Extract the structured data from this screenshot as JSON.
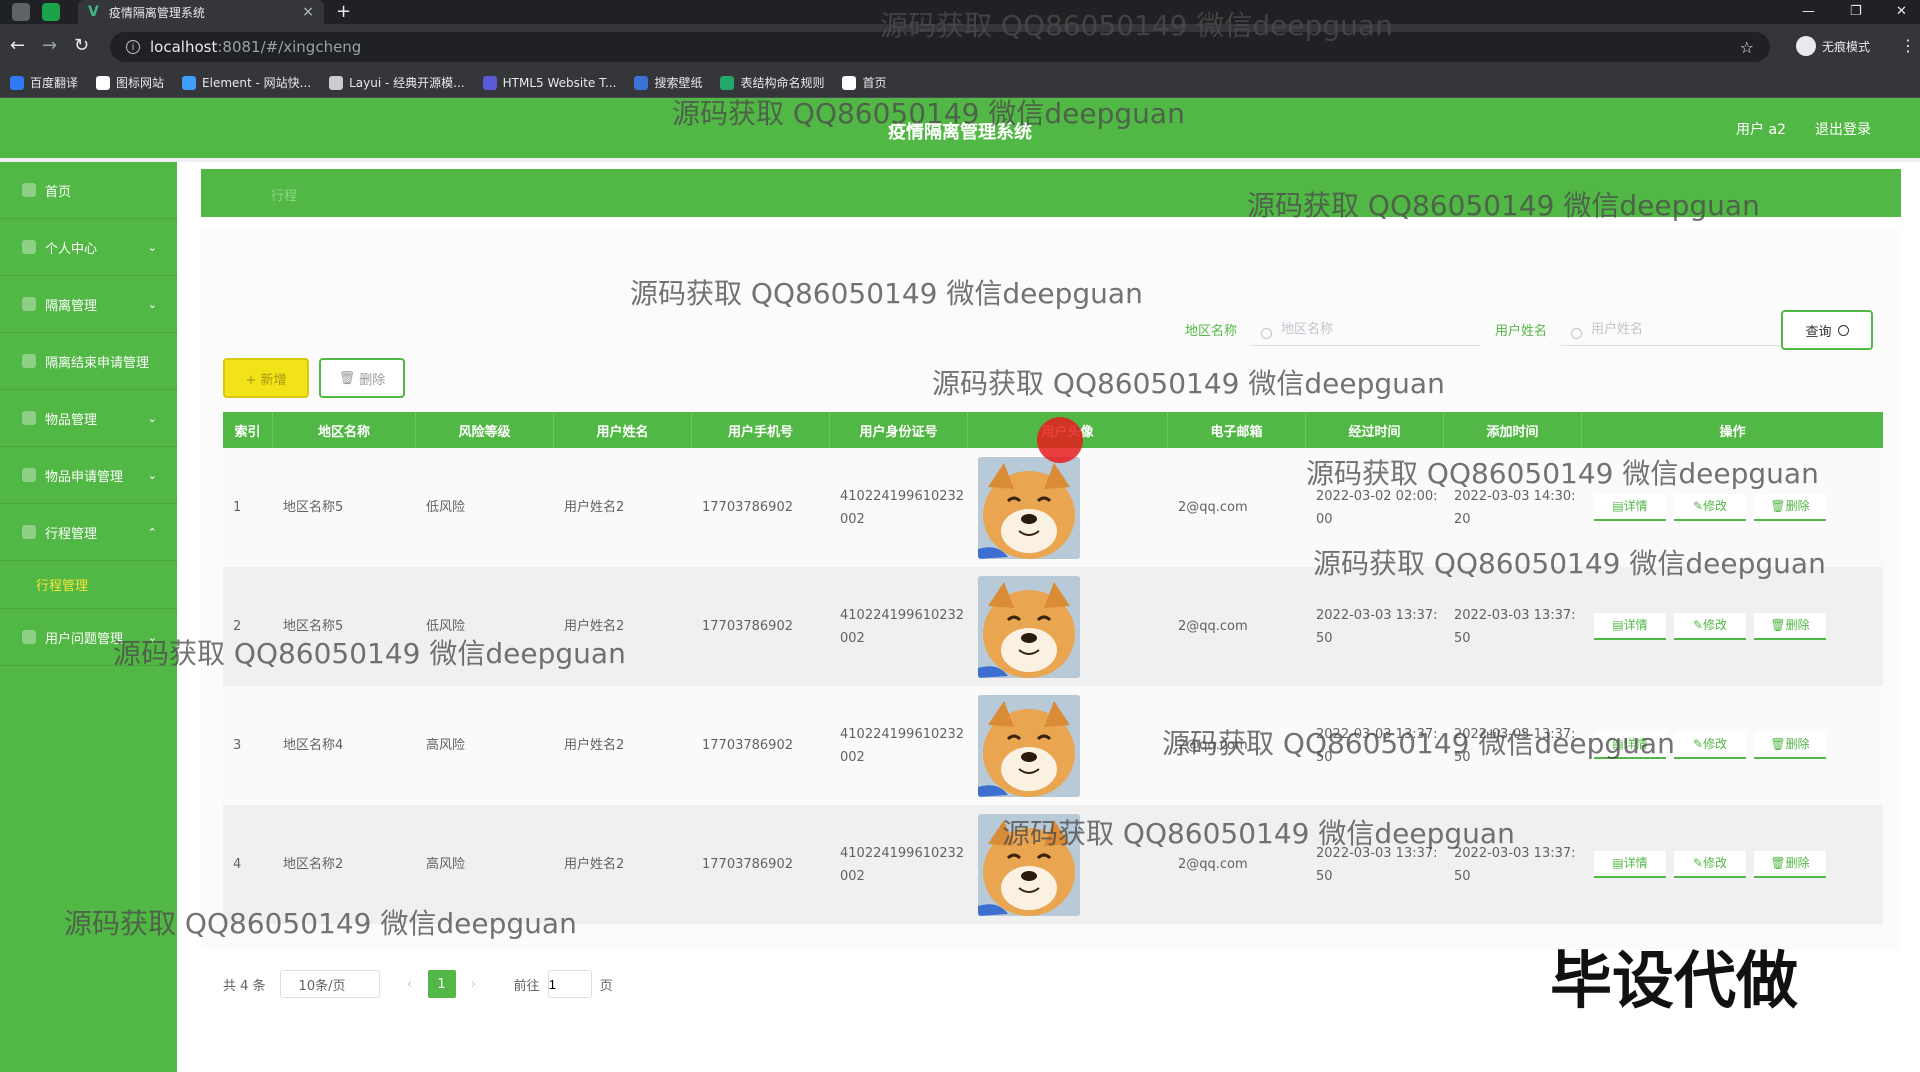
{
  "browser": {
    "tab_title": "疫情隔离管理系统",
    "tab_close": "×",
    "new_tab": "+",
    "url_host": "localhost",
    "url_path": ":8081/#/xingcheng",
    "incognito_label": "无痕模式",
    "bookmarks": [
      {
        "label": "百度翻译",
        "color": "#2f7bf5"
      },
      {
        "label": "图标网站",
        "color": "#ffffff"
      },
      {
        "label": "Element - 网站快...",
        "color": "#409eff"
      },
      {
        "label": "Layui - 经典开源模...",
        "color": "#cccccc"
      },
      {
        "label": "HTML5 Website T...",
        "color": "#5a5ad6"
      },
      {
        "label": "搜索壁纸",
        "color": "#3a72d6"
      },
      {
        "label": "表结构命名规则",
        "color": "#22a86b"
      },
      {
        "label": "首页",
        "color": "#ffffff"
      }
    ]
  },
  "header": {
    "title": "疫情隔离管理系统",
    "user": "用户 a2",
    "logout": "退出登录"
  },
  "sidebar": {
    "items": [
      {
        "label": "首页",
        "has_chevron": false
      },
      {
        "label": "个人中心",
        "has_chevron": true
      },
      {
        "label": "隔离管理",
        "has_chevron": true
      },
      {
        "label": "隔离结束申请管理",
        "has_chevron": false
      },
      {
        "label": "物品管理",
        "has_chevron": true
      },
      {
        "label": "物品申请管理",
        "has_chevron": true
      },
      {
        "label": "行程管理",
        "has_chevron": true,
        "expanded": true
      },
      {
        "label": "用户问题管理",
        "has_chevron": true
      }
    ],
    "sub_item": "行程管理"
  },
  "breadcrumb": "行程",
  "search": {
    "region_label": "地区名称",
    "region_placeholder": "地区名称",
    "username_label": "用户姓名",
    "username_placeholder": "用户姓名",
    "query_button": "查询"
  },
  "toolbar": {
    "add_label": "+ 新增",
    "delete_label": "删除"
  },
  "table": {
    "columns": [
      "索引",
      "地区名称",
      "风险等级",
      "用户姓名",
      "用户手机号",
      "用户身份证号",
      "用户头像",
      "电子邮箱",
      "经过时间",
      "添加时间",
      "操作"
    ],
    "rows": [
      {
        "index": "1",
        "region": "地区名称5",
        "risk": "低风险",
        "name": "用户姓名2",
        "phone": "17703786902",
        "idcard": "410224199610232002",
        "email": "2@qq.com",
        "pass_time": "2022-03-02 02:00:00",
        "add_time": "2022-03-03 14:30:20"
      },
      {
        "index": "2",
        "region": "地区名称5",
        "risk": "低风险",
        "name": "用户姓名2",
        "phone": "17703786902",
        "idcard": "410224199610232002",
        "email": "2@qq.com",
        "pass_time": "2022-03-03 13:37:50",
        "add_time": "2022-03-03 13:37:50"
      },
      {
        "index": "3",
        "region": "地区名称4",
        "risk": "高风险",
        "name": "用户姓名2",
        "phone": "17703786902",
        "idcard": "410224199610232002",
        "email": "2@qq.com",
        "pass_time": "2022-03-03 13:37:50",
        "add_time": "2022-03-03 13:37:50"
      },
      {
        "index": "4",
        "region": "地区名称2",
        "risk": "高风险",
        "name": "用户姓名2",
        "phone": "17703786902",
        "idcard": "410224199610232002",
        "email": "2@qq.com",
        "pass_time": "2022-03-03 13:37:50",
        "add_time": "2022-03-03 13:37:50"
      }
    ],
    "actions": {
      "detail": "详情",
      "edit": "修改",
      "delete": "删除"
    }
  },
  "pager": {
    "total": "共 4 条",
    "page_size": "10条/页",
    "prev": "‹",
    "current": "1",
    "next": "›",
    "goto": "前往",
    "page_value": "1",
    "page_unit": "页"
  },
  "watermark_text": "源码获取 QQ86050149 微信deepguan",
  "stamp_text": "毕设代做",
  "colors": {
    "primary_green": "#52b845",
    "highlight_yellow": "#f2e318",
    "active_submenu": "#f5e53a"
  }
}
